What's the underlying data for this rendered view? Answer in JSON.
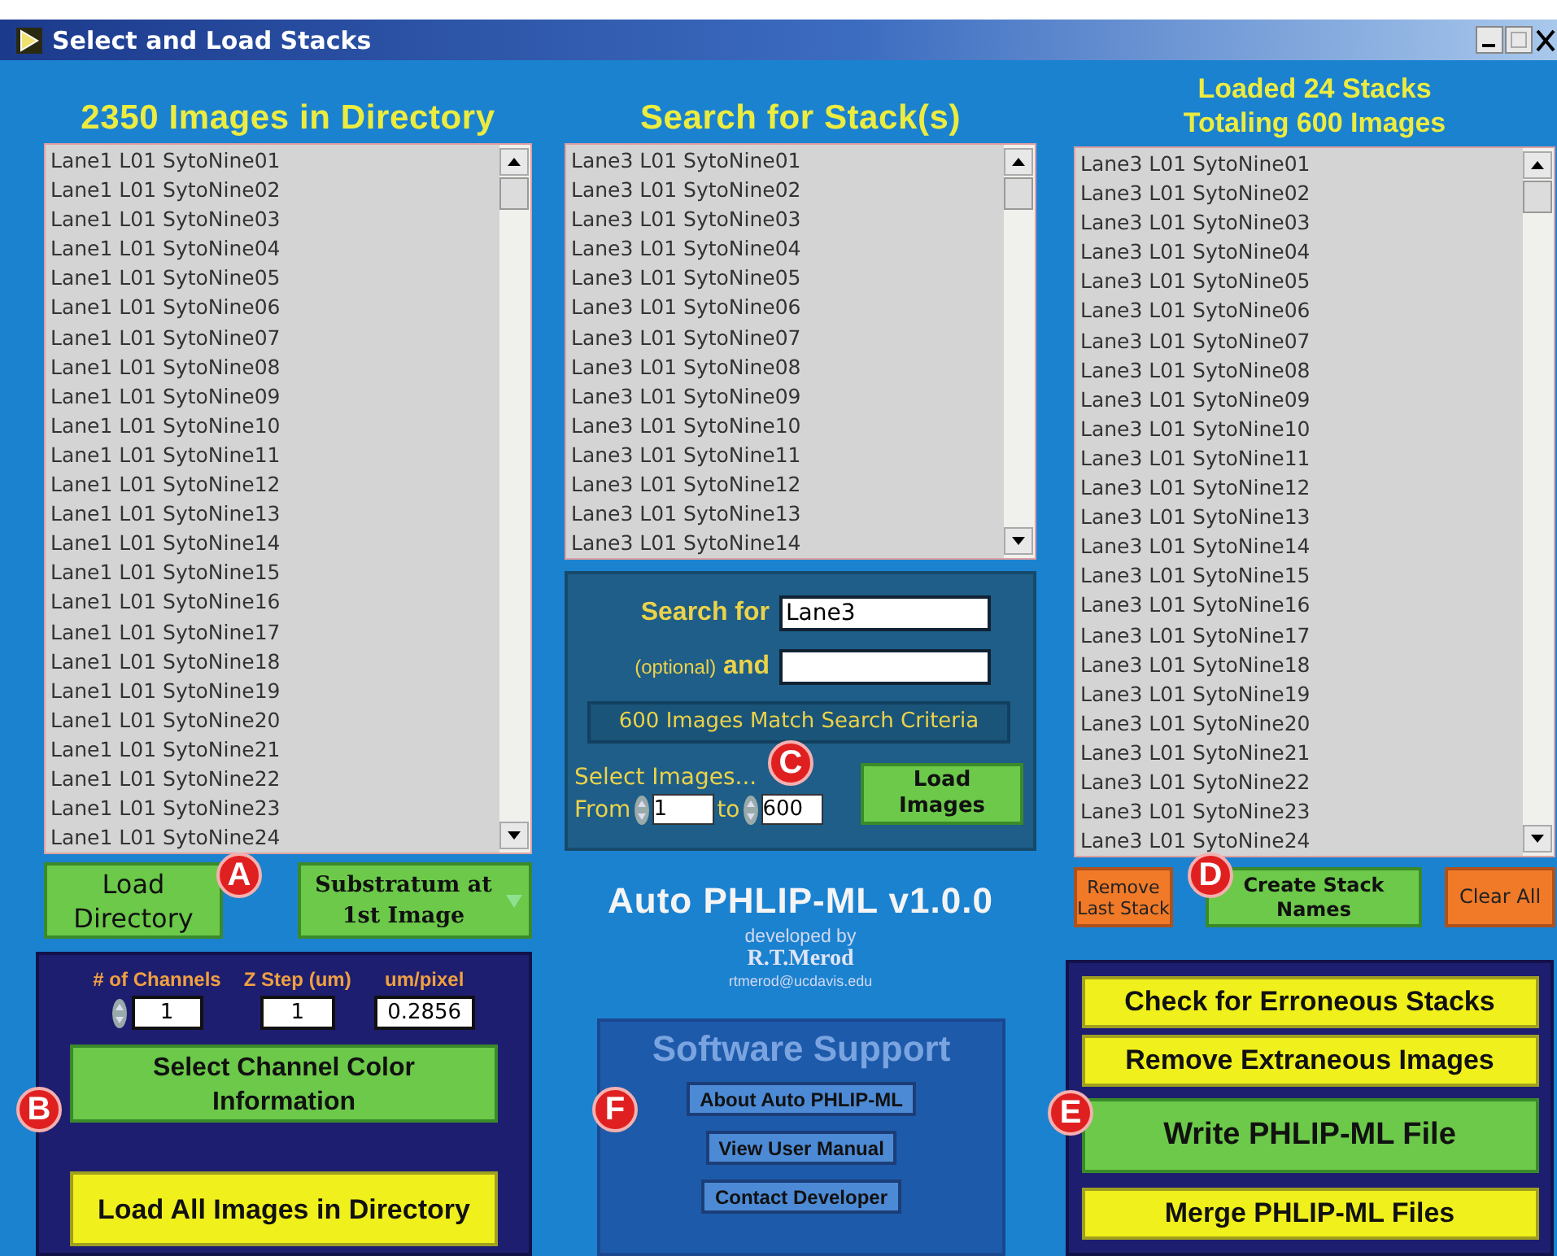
{
  "window": {
    "title": "Select and Load Stacks"
  },
  "directory": {
    "heading": "2350 Images in Directory",
    "items": [
      "Lane1 L01 SytoNine01",
      "Lane1 L01 SytoNine02",
      "Lane1 L01 SytoNine03",
      "Lane1 L01 SytoNine04",
      "Lane1 L01 SytoNine05",
      "Lane1 L01 SytoNine06",
      "Lane1 L01 SytoNine07",
      "Lane1 L01 SytoNine08",
      "Lane1 L01 SytoNine09",
      "Lane1 L01 SytoNine10",
      "Lane1 L01 SytoNine11",
      "Lane1 L01 SytoNine12",
      "Lane1 L01 SytoNine13",
      "Lane1 L01 SytoNine14",
      "Lane1 L01 SytoNine15",
      "Lane1 L01 SytoNine16",
      "Lane1 L01 SytoNine17",
      "Lane1 L01 SytoNine18",
      "Lane1 L01 SytoNine19",
      "Lane1 L01 SytoNine20",
      "Lane1 L01 SytoNine21",
      "Lane1 L01 SytoNine22",
      "Lane1 L01 SytoNine23",
      "Lane1 L01 SytoNine24"
    ],
    "load_button": "Load Directory",
    "substratum_dropdown": "Substratum at 1st Image"
  },
  "settings": {
    "fields": [
      {
        "label": "# of Channels",
        "value": "1",
        "kind": "spinner"
      },
      {
        "label": "Z Step (um)",
        "value": "1",
        "kind": "plain"
      },
      {
        "label": "um/pixel",
        "value": "0.2856",
        "kind": "plain"
      }
    ],
    "channel_button": "Select Channel Color Information",
    "load_all_button": "Load All Images in Directory"
  },
  "search": {
    "heading": "Search for Stack(s)",
    "items": [
      "Lane3 L01 SytoNine01",
      "Lane3 L01 SytoNine02",
      "Lane3 L01 SytoNine03",
      "Lane3 L01 SytoNine04",
      "Lane3 L01 SytoNine05",
      "Lane3 L01 SytoNine06",
      "Lane3 L01 SytoNine07",
      "Lane3 L01 SytoNine08",
      "Lane3 L01 SytoNine09",
      "Lane3 L01 SytoNine10",
      "Lane3 L01 SytoNine11",
      "Lane3 L01 SytoNine12",
      "Lane3 L01 SytoNine13",
      "Lane3 L01 SytoNine14"
    ],
    "search_label": "Search for",
    "search_value": "Lane3",
    "and_note": "(optional)",
    "and_label": "and",
    "match_status": "600 Images Match Search Criteria",
    "select_label": "Select Images...",
    "from_label": "From",
    "from_value": "1",
    "to_label": "to",
    "to_value": "600",
    "load_button": "Load Images"
  },
  "about": {
    "title": "Auto PHLIP-ML v1.0.0",
    "developed_by": "developed by",
    "author": "R.T.Merod",
    "email": "rtmerod@ucdavis.edu"
  },
  "support": {
    "title": "Software Support",
    "buttons": [
      "About Auto PHLIP-ML",
      "View User Manual",
      "Contact Developer"
    ]
  },
  "loaded": {
    "heading_lines": [
      "Loaded 24 Stacks",
      "Totaling 600 Images"
    ],
    "items": [
      "Lane3 L01 SytoNine01",
      "Lane3 L01 SytoNine02",
      "Lane3 L01 SytoNine03",
      "Lane3 L01 SytoNine04",
      "Lane3 L01 SytoNine05",
      "Lane3 L01 SytoNine06",
      "Lane3 L01 SytoNine07",
      "Lane3 L01 SytoNine08",
      "Lane3 L01 SytoNine09",
      "Lane3 L01 SytoNine10",
      "Lane3 L01 SytoNine11",
      "Lane3 L01 SytoNine12",
      "Lane3 L01 SytoNine13",
      "Lane3 L01 SytoNine14",
      "Lane3 L01 SytoNine15",
      "Lane3 L01 SytoNine16",
      "Lane3 L01 SytoNine17",
      "Lane3 L01 SytoNine18",
      "Lane3 L01 SytoNine19",
      "Lane3 L01 SytoNine20",
      "Lane3 L01 SytoNine21",
      "Lane3 L01 SytoNine22",
      "Lane3 L01 SytoNine23",
      "Lane3 L01 SytoNine24"
    ],
    "remove_button": "Remove Last Stack",
    "create_button": "Create Stack Names",
    "clear_button": "Clear All"
  },
  "actions": [
    {
      "label": "Check for Erroneous Stacks",
      "kind": "secondary"
    },
    {
      "label": "Remove Extraneous Images",
      "kind": "secondary"
    },
    {
      "label": "Write PHLIP-ML File",
      "kind": "primary"
    },
    {
      "label": "Merge PHLIP-ML Files",
      "kind": "secondary"
    }
  ],
  "markers": [
    "C",
    "A",
    "D",
    "B",
    "F",
    "E"
  ]
}
